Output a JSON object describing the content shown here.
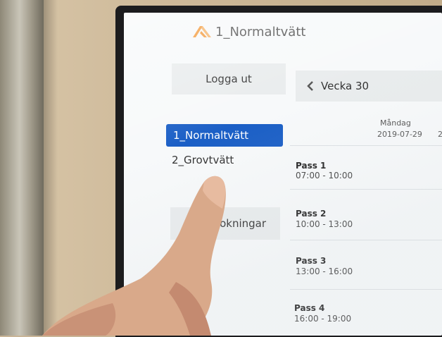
{
  "app": {
    "title": "1_Normaltvätt",
    "logo_icon": "machine-logo-icon",
    "accent_color": "#f39a3c"
  },
  "sidebar": {
    "logout_label": "Logga ut",
    "machines": [
      {
        "label": "1_Normaltvätt",
        "selected": true
      },
      {
        "label": "2_Grovtvätt",
        "selected": false
      }
    ],
    "my_bookings_label": "Mina bokningar",
    "selected_color": "#1b5fc6"
  },
  "calendar": {
    "week_label": "Vecka 30",
    "week_prev_icon": "chevron-left-icon",
    "day": {
      "name": "Måndag",
      "date": "2019-07-29"
    },
    "next_day_partial": "2",
    "slots": [
      {
        "name": "Pass 1",
        "time": "07:00 - 10:00"
      },
      {
        "name": "Pass 2",
        "time": "10:00 - 13:00"
      },
      {
        "name": "Pass 3",
        "time": "13:00 - 16:00"
      },
      {
        "name": "Pass 4",
        "time": "16:00 - 19:00"
      }
    ]
  }
}
